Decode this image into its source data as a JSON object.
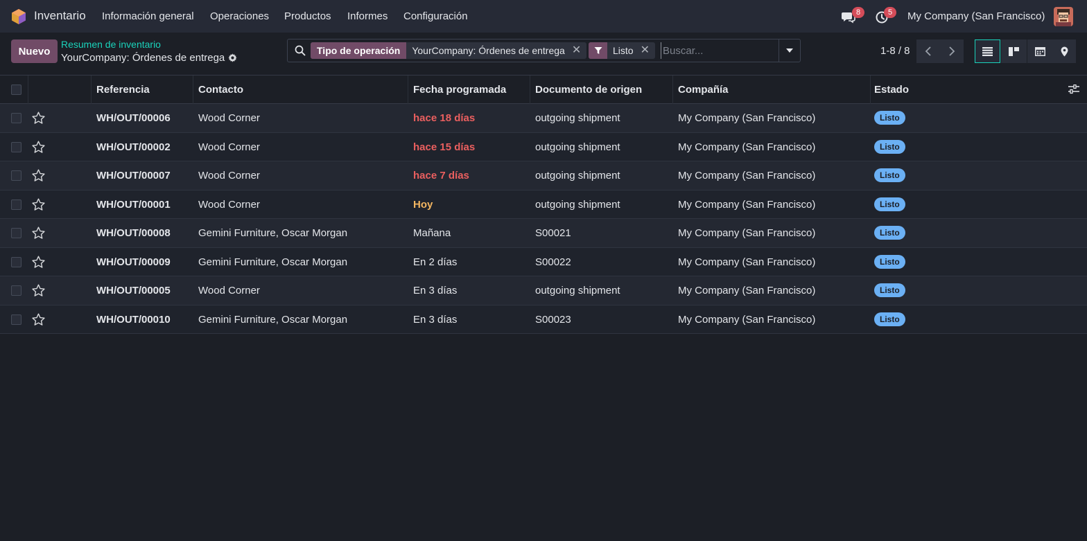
{
  "navbar": {
    "app_name": "Inventario",
    "menu": [
      "Información general",
      "Operaciones",
      "Productos",
      "Informes",
      "Configuración"
    ],
    "messages_count": "8",
    "activities_count": "5",
    "company": "My Company (San Francisco)"
  },
  "control_panel": {
    "new_label": "Nuevo",
    "breadcrumb_parent": "Resumen de inventario",
    "breadcrumb_current": "YourCompany: Órdenes de entrega",
    "search": {
      "facet_group_label": "Tipo de operación",
      "facet_group_value": "YourCompany: Órdenes de entrega",
      "facet_filter_value": "Listo",
      "placeholder": "Buscar..."
    },
    "pager": "1-8 / 8"
  },
  "table": {
    "headers": [
      "Referencia",
      "Contacto",
      "Fecha programada",
      "Documento de origen",
      "Compañía",
      "Estado"
    ],
    "rows": [
      {
        "ref": "WH/OUT/00006",
        "contact": "Wood Corner",
        "date": "hace 18 días",
        "date_state": "danger",
        "origin": "outgoing shipment",
        "company": "My Company (San Francisco)",
        "state": "Listo"
      },
      {
        "ref": "WH/OUT/00002",
        "contact": "Wood Corner",
        "date": "hace 15 días",
        "date_state": "danger",
        "origin": "outgoing shipment",
        "company": "My Company (San Francisco)",
        "state": "Listo"
      },
      {
        "ref": "WH/OUT/00007",
        "contact": "Wood Corner",
        "date": "hace 7 días",
        "date_state": "danger",
        "origin": "outgoing shipment",
        "company": "My Company (San Francisco)",
        "state": "Listo"
      },
      {
        "ref": "WH/OUT/00001",
        "contact": "Wood Corner",
        "date": "Hoy",
        "date_state": "warning",
        "origin": "outgoing shipment",
        "company": "My Company (San Francisco)",
        "state": "Listo"
      },
      {
        "ref": "WH/OUT/00008",
        "contact": "Gemini Furniture, Oscar Morgan",
        "date": "Mañana",
        "date_state": "normal",
        "origin": "S00021",
        "company": "My Company (San Francisco)",
        "state": "Listo"
      },
      {
        "ref": "WH/OUT/00009",
        "contact": "Gemini Furniture, Oscar Morgan",
        "date": "En 2 días",
        "date_state": "normal",
        "origin": "S00022",
        "company": "My Company (San Francisco)",
        "state": "Listo"
      },
      {
        "ref": "WH/OUT/00005",
        "contact": "Wood Corner",
        "date": "En 3 días",
        "date_state": "normal",
        "origin": "outgoing shipment",
        "company": "My Company (San Francisco)",
        "state": "Listo"
      },
      {
        "ref": "WH/OUT/00010",
        "contact": "Gemini Furniture, Oscar Morgan",
        "date": "En 3 días",
        "date_state": "normal",
        "origin": "S00023",
        "company": "My Company (San Francisco)",
        "state": "Listo"
      }
    ]
  },
  "colors": {
    "brand": "#714b67",
    "link": "#1ad3bb",
    "danger": "#ea5f5f",
    "warning": "#f3b661",
    "state_badge": "#6bb0f4"
  },
  "icons": [
    "app-logo-icon",
    "chat-icon",
    "clock-icon",
    "gear-icon",
    "search-icon",
    "filter-icon",
    "close-icon",
    "caret-down-icon",
    "chevron-left-icon",
    "chevron-right-icon",
    "list-view-icon",
    "kanban-view-icon",
    "calendar-view-icon",
    "map-view-icon",
    "star-icon",
    "optional-columns-icon"
  ]
}
